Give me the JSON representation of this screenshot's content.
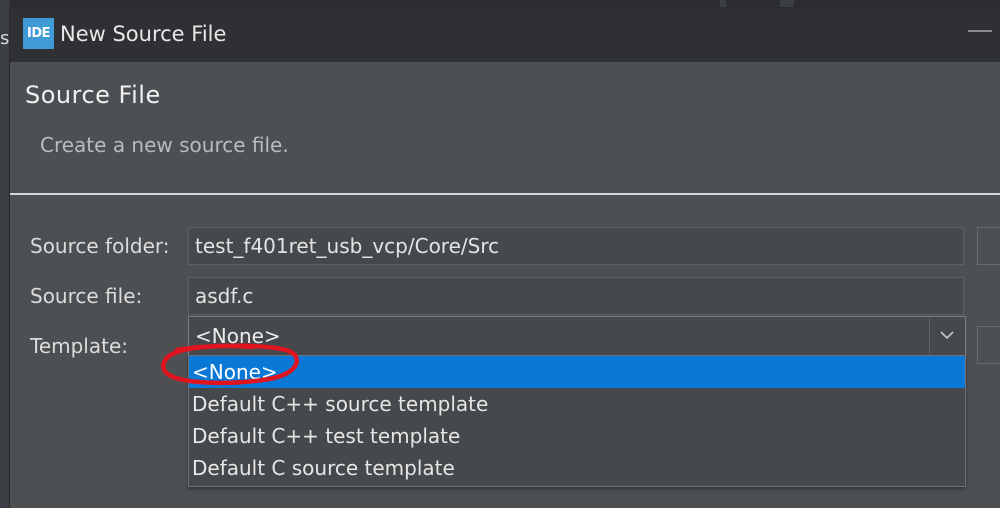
{
  "window": {
    "title": "New Source File",
    "app_icon_text": "IDE"
  },
  "background_app": {
    "edge_letter": "s"
  },
  "banner": {
    "title": "Source File",
    "description": "Create a new source file."
  },
  "form": {
    "source_folder": {
      "label": "Source folder:",
      "value": "test_f401ret_usb_vcp/Core/Src"
    },
    "source_file": {
      "label": "Source file:",
      "value": "asdf.c"
    },
    "template": {
      "label": "Template:",
      "selected": "<None>",
      "options": [
        "<None>",
        "Default C++ source template",
        "Default C++ test template",
        "Default C source template"
      ]
    }
  },
  "colors": {
    "dialog_bg": "#4c5052",
    "titlebar_bg": "#2f3033",
    "selection": "#0a78d7",
    "annotation_ring": "#e0141e",
    "icon_bg": "#3e9bd6"
  },
  "icons": {
    "app": "ide-logo-icon",
    "combo_arrow": "chevron-down-icon",
    "minimize": "minimize-icon"
  }
}
